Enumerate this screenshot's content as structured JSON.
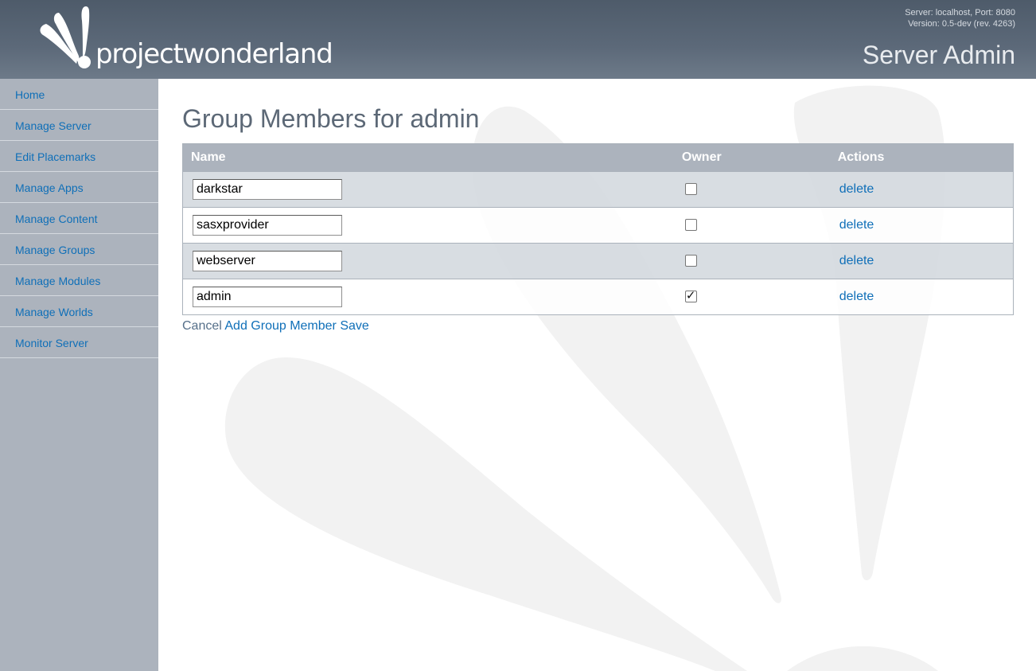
{
  "header": {
    "logo_text": "projectwonderland",
    "server_line": "Server: localhost, Port: 8080",
    "version_line": "Version: 0.5-dev (rev. 4263)",
    "title": "Server Admin"
  },
  "sidebar": {
    "items": [
      {
        "label": "Home"
      },
      {
        "label": "Manage Server"
      },
      {
        "label": "Edit Placemarks"
      },
      {
        "label": "Manage Apps"
      },
      {
        "label": "Manage Content"
      },
      {
        "label": "Manage Groups"
      },
      {
        "label": "Manage Modules"
      },
      {
        "label": "Manage Worlds"
      },
      {
        "label": "Monitor Server"
      }
    ]
  },
  "main": {
    "title": "Group Members for admin",
    "columns": {
      "name": "Name",
      "owner": "Owner",
      "actions": "Actions"
    },
    "members": [
      {
        "name": "darkstar",
        "owner": false,
        "action": "delete"
      },
      {
        "name": "sasxprovider",
        "owner": false,
        "action": "delete"
      },
      {
        "name": "webserver",
        "owner": false,
        "action": "delete"
      },
      {
        "name": "admin",
        "owner": true,
        "action": "delete"
      }
    ],
    "buttons": {
      "cancel": "Cancel",
      "add": "Add Group Member",
      "save": "Save"
    }
  },
  "colors": {
    "header": "#56636f",
    "sidebar": "#acb3bd",
    "link": "#0f6fb8",
    "title": "#5c6876"
  }
}
